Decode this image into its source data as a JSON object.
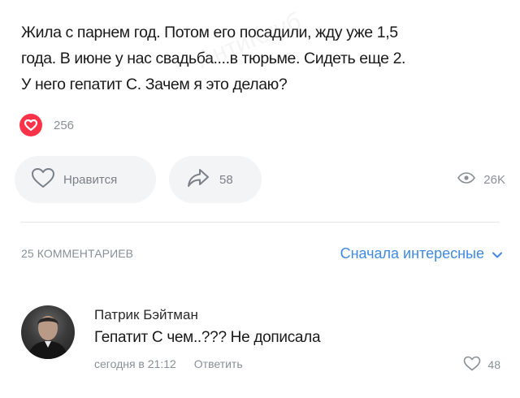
{
  "post": {
    "lines": [
      "Жила с парнем год. Потом его посадили, жду уже 1,5",
      "года. В июне у нас свадьба....в тюрьме. Сидеть еще 2.",
      "У него гепатит С. Зачем я это делаю?"
    ],
    "watermark": "АнтиКлуб",
    "reactions_count": "256",
    "like_label": "Нравится",
    "shares_count": "58",
    "views_count": "26K"
  },
  "comments_header": {
    "count_label": "25 КОММЕНТАРИЕВ",
    "sort_label": "Сначала интересные"
  },
  "comment": {
    "author": "Патрик Бэйтман",
    "text": "Гепатит С чем..??? Не дописала",
    "time": "сегодня в 21:12",
    "reply_label": "Ответить",
    "likes": "48"
  },
  "colors": {
    "accent": "#3f8ae0",
    "reaction": "#ff3347",
    "muted": "#8a8f96"
  },
  "icons": [
    "heart-icon",
    "share-icon",
    "eye-icon",
    "chevron-down-icon",
    "avatar"
  ]
}
